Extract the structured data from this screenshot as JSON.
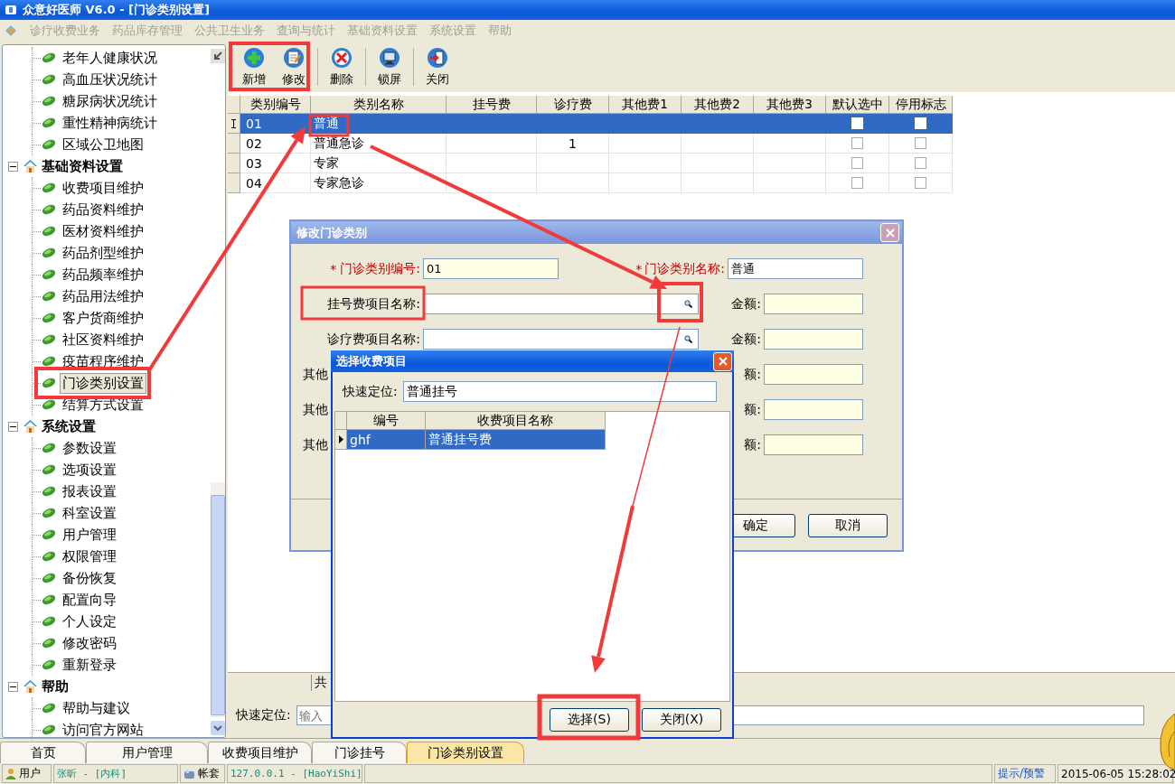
{
  "window": {
    "title": "众意好医师 V6.0 - [门诊类别设置]"
  },
  "menu": [
    "诊疗收费业务",
    "药品库存管理",
    "公共卫生业务",
    "查询与统计",
    "基础资料设置",
    "系统设置",
    "帮助"
  ],
  "sidebar": {
    "tree": [
      {
        "children": [
          {
            "label": "老年人健康状况",
            "selected": false
          },
          {
            "label": "高血压状况统计",
            "selected": false
          },
          {
            "label": "糖尿病状况统计",
            "selected": false
          },
          {
            "label": "重性精神病统计",
            "selected": false
          },
          {
            "label": "区域公卫地图",
            "selected": false
          }
        ]
      },
      {
        "label": "基础资料设置",
        "expanded": true,
        "children": [
          {
            "label": "收费项目维护",
            "selected": false
          },
          {
            "label": "药品资料维护",
            "selected": false
          },
          {
            "label": "医材资料维护",
            "selected": false
          },
          {
            "label": "药品剂型维护",
            "selected": false
          },
          {
            "label": "药品频率维护",
            "selected": false
          },
          {
            "label": "药品用法维护",
            "selected": false
          },
          {
            "label": "客户货商维护",
            "selected": false
          },
          {
            "label": "社区资料维护",
            "selected": false
          },
          {
            "label": "疫苗程序维护",
            "selected": false
          },
          {
            "label": "门诊类别设置",
            "selected": true
          },
          {
            "label": "结算方式设置",
            "selected": false
          }
        ]
      },
      {
        "label": "系统设置",
        "expanded": true,
        "children": [
          {
            "label": "参数设置",
            "selected": false
          },
          {
            "label": "选项设置",
            "selected": false
          },
          {
            "label": "报表设置",
            "selected": false
          },
          {
            "label": "科室设置",
            "selected": false
          },
          {
            "label": "用户管理",
            "selected": false
          },
          {
            "label": "权限管理",
            "selected": false
          },
          {
            "label": "备份恢复",
            "selected": false
          },
          {
            "label": "配置向导",
            "selected": false
          },
          {
            "label": "个人设定",
            "selected": false
          },
          {
            "label": "修改密码",
            "selected": false
          },
          {
            "label": "重新登录",
            "selected": false
          }
        ]
      },
      {
        "label": "帮助",
        "expanded": true,
        "children": [
          {
            "label": "帮助与建议",
            "selected": false
          },
          {
            "label": "访问官方网站",
            "selected": false
          }
        ]
      }
    ]
  },
  "toolbar": [
    {
      "label": "新增",
      "kind": "add"
    },
    {
      "label": "修改",
      "kind": "edit"
    },
    {
      "label": "删除",
      "kind": "delete"
    },
    {
      "label": "锁屏",
      "kind": "lock"
    },
    {
      "label": "关闭",
      "kind": "exit"
    }
  ],
  "table": {
    "columns": [
      "类别编号",
      "类别名称",
      "挂号费",
      "诊疗费",
      "其他费1",
      "其他费2",
      "其他费3",
      "默认选中",
      "停用标志"
    ],
    "rows": [
      {
        "selected": true,
        "code": "01",
        "name": "普通",
        "default_selected": false,
        "disabled": false
      },
      {
        "selected": false,
        "code": "02",
        "name": "普通急诊",
        "consult_fee": "1",
        "default_selected": false,
        "disabled": false
      },
      {
        "selected": false,
        "code": "03",
        "name": "专家",
        "default_selected": false,
        "disabled": false
      },
      {
        "selected": false,
        "code": "04",
        "name": "专家急诊",
        "default_selected": false,
        "disabled": false
      }
    ]
  },
  "summary_label": "共",
  "quick_search": {
    "label": "快速定位:",
    "placeholder": "输入"
  },
  "tabs": [
    {
      "label": "首页",
      "selected": false
    },
    {
      "label": "用户管理",
      "selected": false
    },
    {
      "label": "收费项目维护",
      "selected": false
    },
    {
      "label": "门诊挂号",
      "selected": false
    },
    {
      "label": "门诊类别设置",
      "selected": true
    }
  ],
  "status_bar": {
    "user_label": "用户",
    "user": "张昕 - [内科]",
    "account_label": "帐套",
    "server": "127.0.0.1 - [HaoYiShi]",
    "alerts": "提示/预警",
    "datetime": "2015-06-05 15:28:02"
  },
  "edit_dialog": {
    "title": "修改门诊类别",
    "rows": [
      {
        "left": {
          "kind": "text",
          "required_mark": "*",
          "label": "门诊类别编号:",
          "value": "01",
          "readonly": true
        },
        "right": {
          "kind": "text",
          "required_mark": "*",
          "label": "门诊类别名称:",
          "value": "普通",
          "readonly": false
        }
      },
      {
        "left": {
          "kind": "lookup",
          "label": "挂号费项目名称:",
          "readonly": false
        },
        "right": {
          "kind": "amount",
          "label": "金额:",
          "readonly": true
        }
      },
      {
        "left": {
          "kind": "lookup",
          "label": "诊疗费项目名称:",
          "readonly": false
        },
        "right": {
          "kind": "amount",
          "label": "金额:",
          "readonly": true
        }
      },
      {
        "left": {
          "kind": "label",
          "label": "其他"
        },
        "right": {
          "kind": "amount",
          "label": "额:",
          "readonly": true
        }
      },
      {
        "left": {
          "kind": "label",
          "label": "其他"
        },
        "right": {
          "kind": "amount",
          "label": "额:",
          "readonly": true
        }
      },
      {
        "left": {
          "kind": "label",
          "label": "其他"
        },
        "right": {
          "kind": "amount",
          "label": "额:",
          "readonly": true
        }
      }
    ],
    "buttons": [
      "确定",
      "取消"
    ]
  },
  "select_dialog": {
    "title": "选择收费项目",
    "search_label": "快速定位:",
    "search_value": "普通挂号",
    "columns": [
      "编号",
      "收费项目名称"
    ],
    "rows": [
      {
        "code": "ghf",
        "name": "普通挂号费",
        "selected": true
      }
    ],
    "buttons": [
      "选择(S)",
      "关闭(X)"
    ]
  }
}
